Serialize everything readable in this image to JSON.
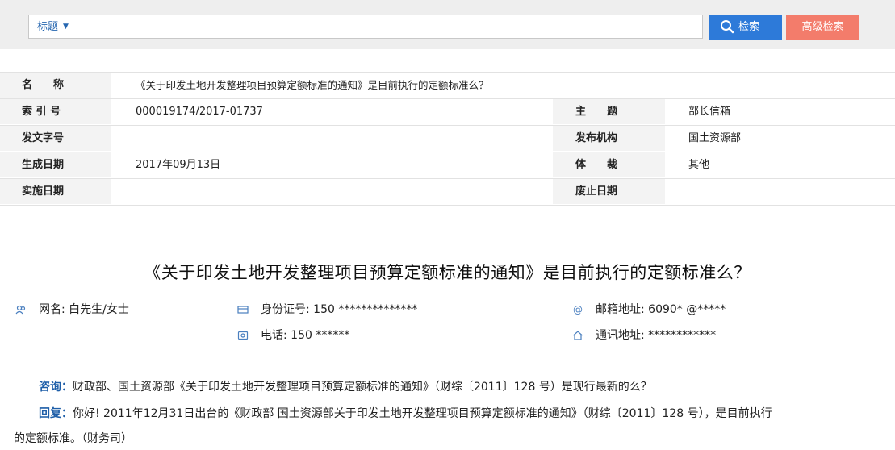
{
  "search": {
    "scope_label": "标题",
    "scope_caret": "▼",
    "query": "",
    "search_button": "检索",
    "advanced_button": "高级检索"
  },
  "meta": {
    "name_label": "名　　称",
    "name_value": "《关于印发土地开发整理项目预算定额标准的通知》是目前执行的定额标准么？",
    "index_label": "索 引 号",
    "index_value": "000019174/2017-01737",
    "subject_label": "主　　题",
    "subject_value": "部长信箱",
    "docno_label": "发文字号",
    "docno_value": "",
    "publisher_label": "发布机构",
    "publisher_value": "国土资源部",
    "date_label": "生成日期",
    "date_value": "2017年09月13日",
    "genre_label": "体　　裁",
    "genre_value": "其他",
    "effective_label": "实施日期",
    "effective_value": "",
    "expiry_label": "废止日期",
    "expiry_value": ""
  },
  "article": {
    "title": "《关于印发土地开发整理项目预算定额标准的通知》是目前执行的定额标准么？",
    "name_field": "网名: 白先生/女士",
    "id_field": "身份证号: 150 **************",
    "email_field": "邮箱地址: 6090* @*****",
    "phone_field": "电话: 150 ******",
    "address_field": "通讯地址: ************",
    "question_tag": "咨询：",
    "question_text": "财政部、国土资源部《关于印发土地开发整理项目预算定额标准的通知》（财综〔2011〕128 号）是现行最新的么？",
    "reply_tag": "回复：",
    "reply_text_line1": "你好! 2011年12月31日出台的《财政部 国土资源部关于印发土地开发整理项目预算定额标准的通知》（财综〔2011〕128 号），是目前执行",
    "reply_text_line2": "的定额标准。（财务司）"
  },
  "icons": {
    "user": "user-icon",
    "id_card": "id-card-icon",
    "email": "at-icon",
    "phone": "phone-icon",
    "home": "home-icon"
  },
  "colors": {
    "search_button": "#2d7ad9",
    "advanced_button": "#f37c6b",
    "label_bg": "#f3f3f3",
    "accent_blue": "#1e5ea8"
  }
}
